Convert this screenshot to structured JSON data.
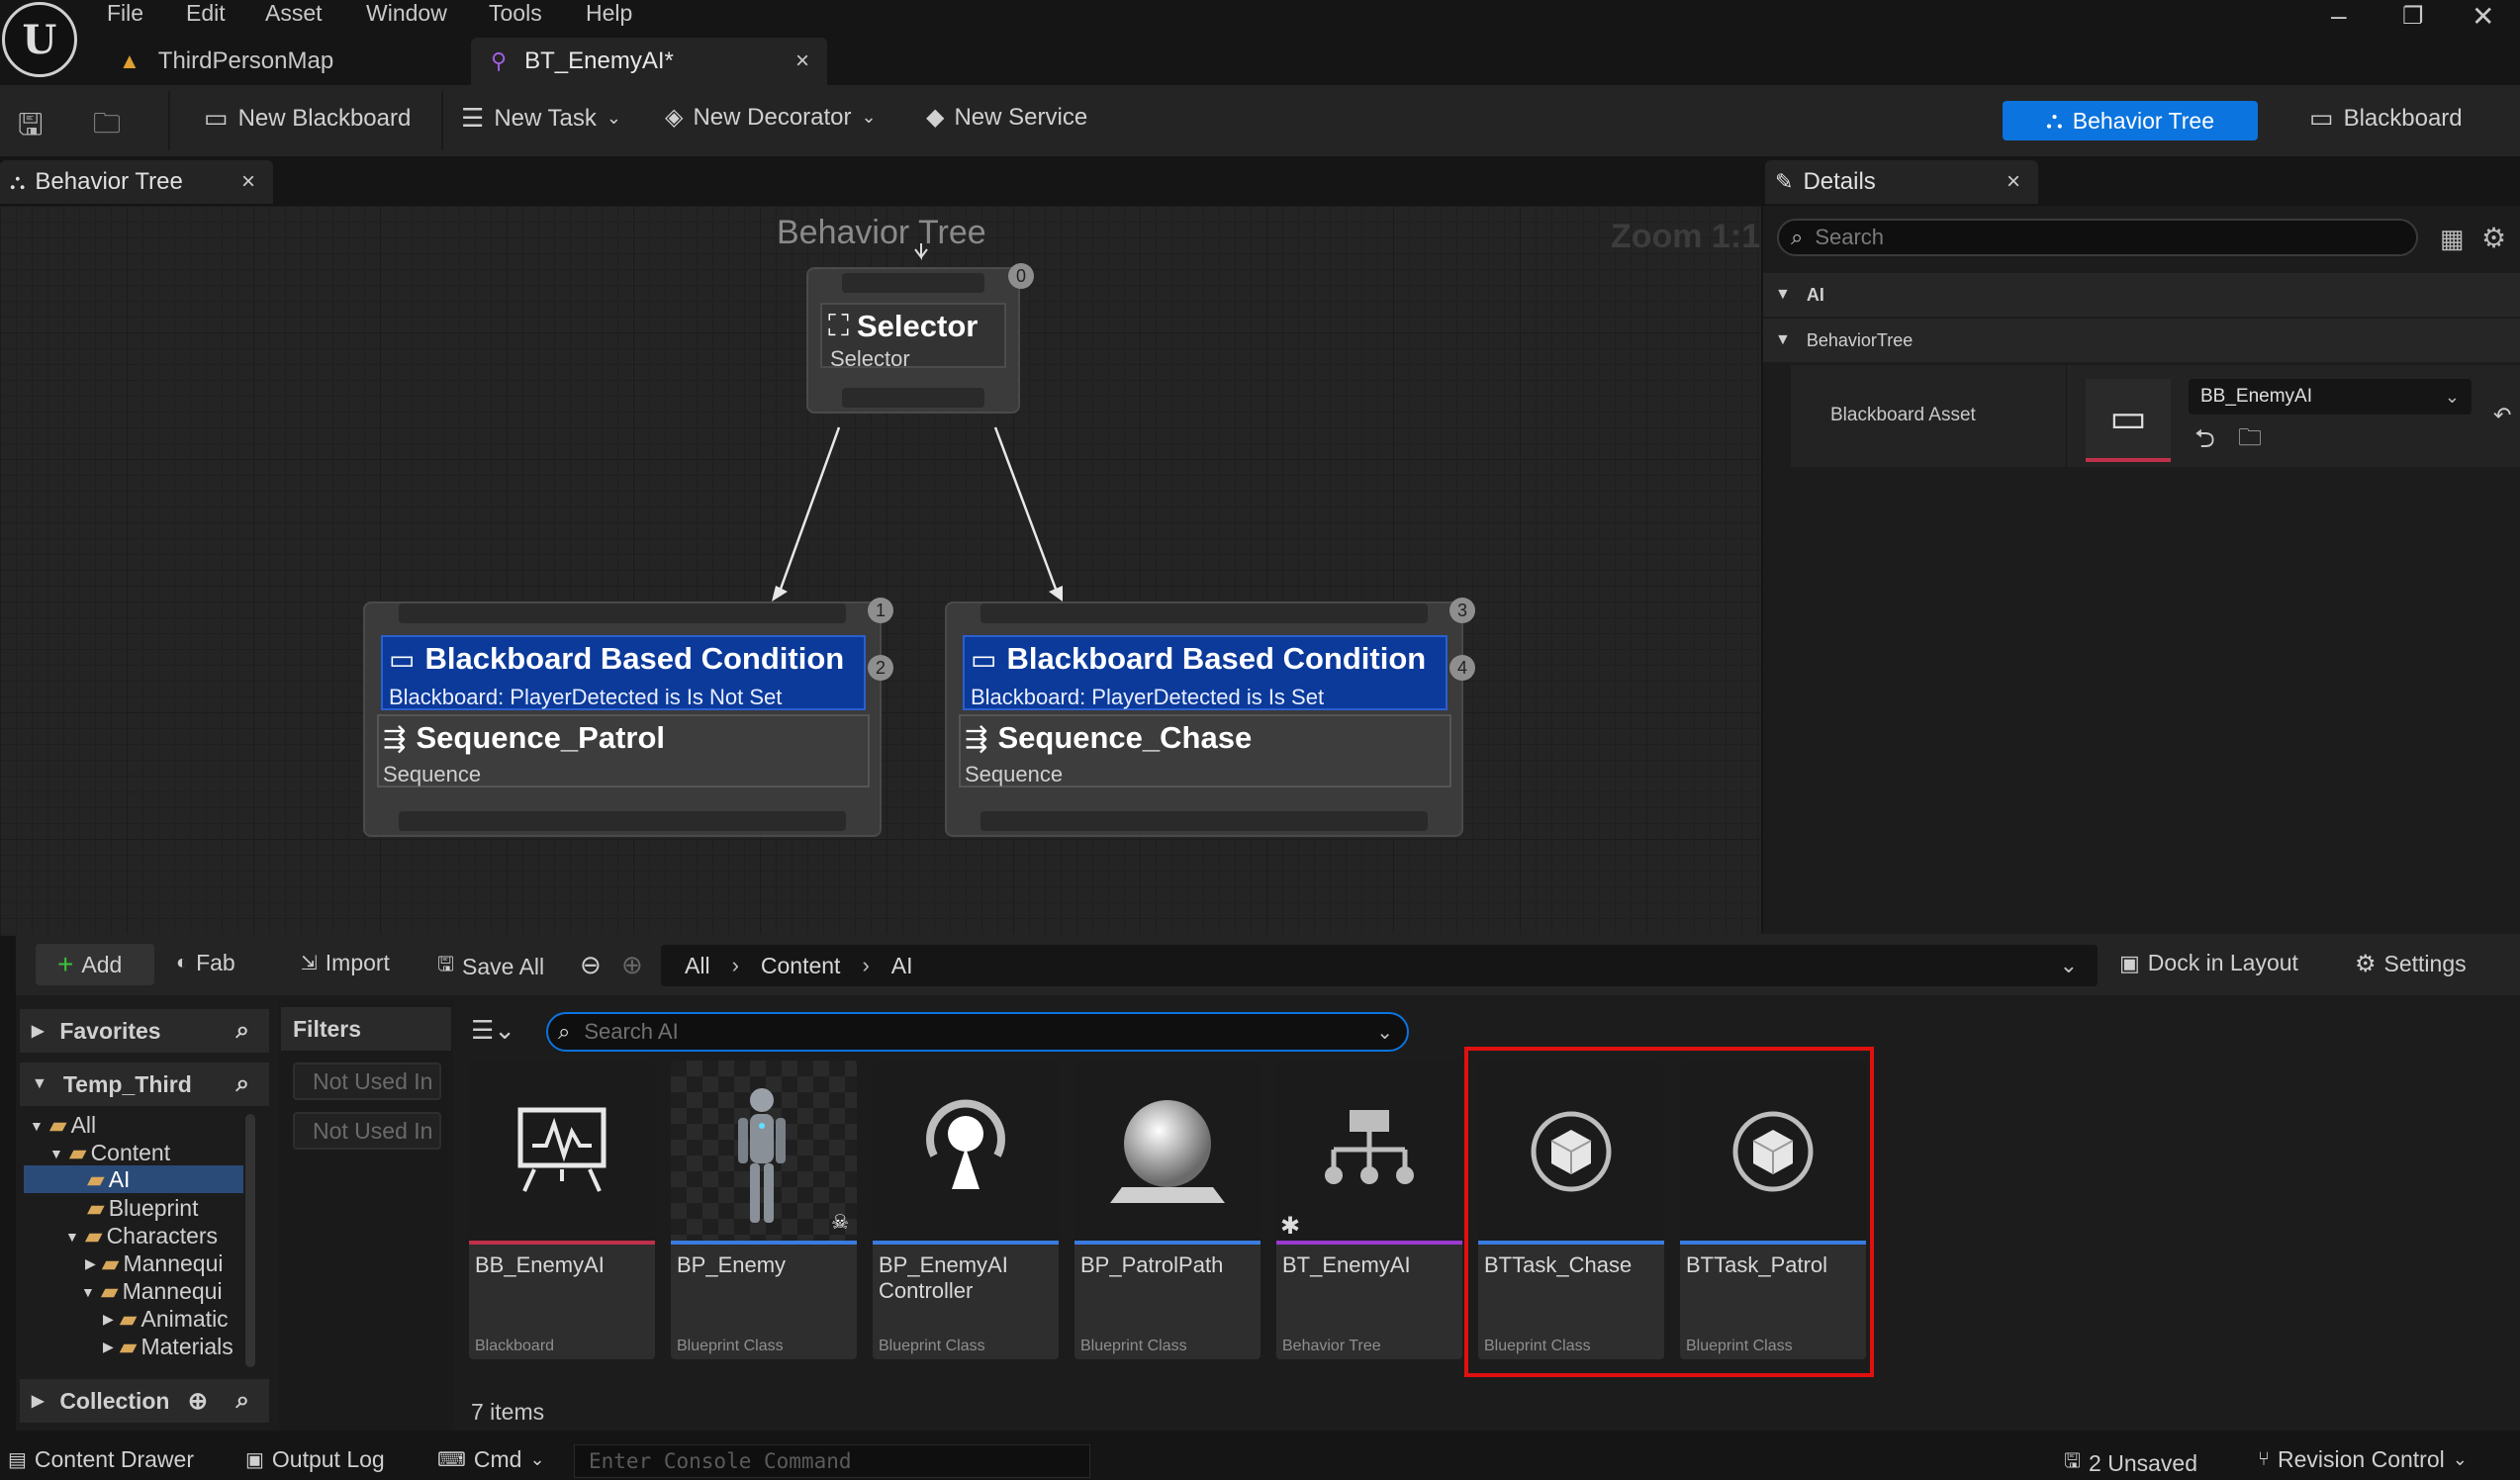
{
  "menu": [
    "File",
    "Edit",
    "Asset",
    "Window",
    "Tools",
    "Help"
  ],
  "doc_tabs": [
    {
      "label": "ThirdPersonMap"
    },
    {
      "label": "BT_EnemyAI*"
    }
  ],
  "toolbar": {
    "new_blackboard": "New Blackboard",
    "new_task": "New Task",
    "new_decorator": "New Decorator",
    "new_service": "New Service",
    "mode_behavior_tree": "Behavior Tree",
    "mode_blackboard": "Blackboard"
  },
  "panels": {
    "graph_tab": "Behavior Tree",
    "details_tab": "Details"
  },
  "graph": {
    "title": "Behavior Tree",
    "zoom": "Zoom 1:1",
    "selector": {
      "title": "Selector",
      "subtitle": "Selector",
      "index": "0"
    },
    "branches": [
      {
        "index_top": "1",
        "index_deco": "2",
        "decorator_title": "Blackboard Based Condition",
        "decorator_sub": "Blackboard: PlayerDetected is Is Not Set",
        "seq_title": "Sequence_Patrol",
        "seq_sub": "Sequence"
      },
      {
        "index_top": "3",
        "index_deco": "4",
        "decorator_title": "Blackboard Based Condition",
        "decorator_sub": "Blackboard: PlayerDetected is Is Set",
        "seq_title": "Sequence_Chase",
        "seq_sub": "Sequence"
      }
    ]
  },
  "details": {
    "search_placeholder": "Search",
    "cat_ai": "AI",
    "cat_behaviortree": "BehaviorTree",
    "prop_label": "Blackboard Asset",
    "prop_value": "BB_EnemyAI"
  },
  "content_browser": {
    "add": "Add",
    "fab": "Fab",
    "import": "Import",
    "save_all": "Save All",
    "breadcrumb": [
      "All",
      "Content",
      "AI"
    ],
    "dock": "Dock in Layout",
    "settings": "Settings",
    "favorites": "Favorites",
    "project": "Temp_Third",
    "collections": "Collection",
    "filters": "Filters",
    "filter_chips": [
      "Not Used In",
      "Not Used In"
    ],
    "search_placeholder": "Search AI",
    "tree": [
      "All",
      "Content",
      "AI",
      "Blueprint",
      "Characters",
      "Mannequi",
      "Mannequi",
      "Animatic",
      "Materials"
    ],
    "items_count": "7 items",
    "assets": [
      {
        "name": "BB_EnemyAI",
        "cls": "Blackboard",
        "icon": "blackboard-icon",
        "color": "#c0304a"
      },
      {
        "name": "BP_Enemy",
        "cls": "Blueprint Class",
        "icon": "mannequin-thumbnail",
        "color": "#3a7be0"
      },
      {
        "name": "BP_EnemyAI Controller",
        "cls": "Blueprint Class",
        "icon": "ai-controller-icon",
        "color": "#3a7be0"
      },
      {
        "name": "BP_PatrolPath",
        "cls": "Blueprint Class",
        "icon": "sphere-actor-icon",
        "color": "#3a7be0"
      },
      {
        "name": "BT_EnemyAI",
        "cls": "Behavior Tree",
        "icon": "behavior-tree-icon",
        "color": "#9a3ad0"
      },
      {
        "name": "BTTask_Chase",
        "cls": "Blueprint Class",
        "icon": "cube-object-icon",
        "color": "#3a7be0"
      },
      {
        "name": "BTTask_Patrol",
        "cls": "Blueprint Class",
        "icon": "cube-object-icon",
        "color": "#3a7be0"
      }
    ]
  },
  "status": {
    "content_drawer": "Content Drawer",
    "output_log": "Output Log",
    "cmd": "Cmd",
    "console_placeholder": "Enter Console Command",
    "unsaved": "2 Unsaved",
    "revision": "Revision Control"
  }
}
